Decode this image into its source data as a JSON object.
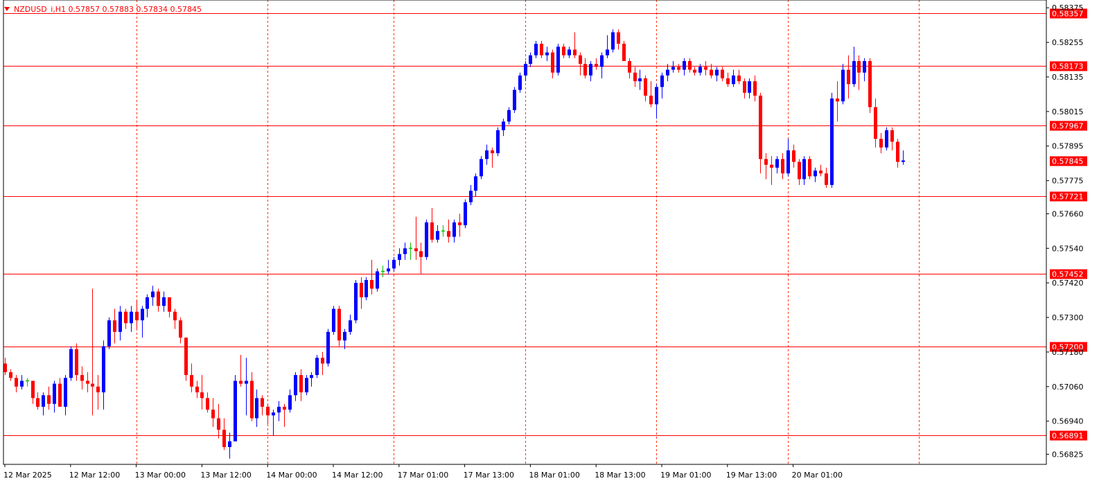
{
  "header": {
    "symbol_line": "NZDUSD_i,H1  0.57857 0.57883 0.57834 0.57845"
  },
  "colors": {
    "bull": "#0000ff",
    "bear": "#ff0000",
    "doji": "#00c000",
    "level_line": "#ff0000",
    "grid": "#ff3300",
    "background": "#ffffff"
  },
  "chart_data": {
    "type": "candlestick",
    "symbol": "NZDUSD_i",
    "timeframe": "H1",
    "ylim": [
      0.5679,
      0.5839
    ],
    "y_ticks": [
      "0.58375",
      "0.58255",
      "0.58135",
      "0.58015",
      "0.57895",
      "0.57775",
      "0.57660",
      "0.57540",
      "0.57420",
      "0.57300",
      "0.57180",
      "0.57060",
      "0.56940",
      "0.56825"
    ],
    "x_labels": [
      "12 Mar 2025",
      "12 Mar 12:00",
      "13 Mar 00:00",
      "13 Mar 12:00",
      "14 Mar 00:00",
      "14 Mar 12:00",
      "17 Mar 01:00",
      "17 Mar 13:00",
      "18 Mar 01:00",
      "18 Mar 13:00",
      "19 Mar 01:00",
      "19 Mar 13:00",
      "20 Mar 01:00"
    ],
    "x_label_slots": [
      0,
      12,
      24,
      36,
      48,
      60,
      72,
      84,
      96,
      108,
      120,
      132,
      144
    ],
    "separator_slots": [
      24,
      48,
      71,
      95,
      119,
      143,
      167
    ],
    "horizontal_levels": [
      "0.58357",
      "0.58173",
      "0.57967",
      "0.57721",
      "0.57452",
      "0.57200",
      "0.56891"
    ],
    "current_price": "0.57845",
    "candles": [
      [
        0.5714,
        0.5716,
        0.571,
        0.5711
      ],
      [
        0.5711,
        0.5712,
        0.5708,
        0.5709
      ],
      [
        0.5709,
        0.571,
        0.5704,
        0.5706
      ],
      [
        0.5706,
        0.571,
        0.5705,
        0.5708
      ],
      [
        0.5708,
        0.5709,
        0.5706,
        0.5708
      ],
      [
        0.5708,
        0.5708,
        0.57,
        0.5702
      ],
      [
        0.5702,
        0.5704,
        0.5698,
        0.5699
      ],
      [
        0.5699,
        0.5704,
        0.5696,
        0.5703
      ],
      [
        0.5703,
        0.5706,
        0.5698,
        0.57
      ],
      [
        0.57,
        0.5708,
        0.5697,
        0.5707
      ],
      [
        0.5707,
        0.5709,
        0.57,
        0.5699
      ],
      [
        0.5699,
        0.571,
        0.5696,
        0.5709
      ],
      [
        0.5709,
        0.572,
        0.5708,
        0.5719
      ],
      [
        0.5719,
        0.5721,
        0.5708,
        0.571
      ],
      [
        0.571,
        0.5713,
        0.5705,
        0.5708
      ],
      [
        0.5708,
        0.5711,
        0.5704,
        0.5707
      ],
      [
        0.5707,
        0.574,
        0.5696,
        0.5706
      ],
      [
        0.5706,
        0.571,
        0.5698,
        0.5704
      ],
      [
        0.5704,
        0.5722,
        0.5698,
        0.572
      ],
      [
        0.572,
        0.573,
        0.5719,
        0.5729
      ],
      [
        0.5729,
        0.5733,
        0.5721,
        0.5725
      ],
      [
        0.5725,
        0.5734,
        0.5722,
        0.5732
      ],
      [
        0.5732,
        0.5733,
        0.5726,
        0.5728
      ],
      [
        0.5728,
        0.5734,
        0.5725,
        0.5732
      ],
      [
        0.5732,
        0.5736,
        0.5726,
        0.5729
      ],
      [
        0.5729,
        0.5734,
        0.5723,
        0.5733
      ],
      [
        0.5733,
        0.5738,
        0.573,
        0.5737
      ],
      [
        0.5737,
        0.5741,
        0.5734,
        0.5739
      ],
      [
        0.5739,
        0.574,
        0.5732,
        0.5734
      ],
      [
        0.5734,
        0.5739,
        0.5732,
        0.5737
      ],
      [
        0.5737,
        0.5737,
        0.573,
        0.5732
      ],
      [
        0.5732,
        0.5733,
        0.5726,
        0.5729
      ],
      [
        0.5729,
        0.573,
        0.5721,
        0.5723
      ],
      [
        0.5723,
        0.5723,
        0.5708,
        0.571
      ],
      [
        0.571,
        0.5714,
        0.5704,
        0.5706
      ],
      [
        0.5706,
        0.5708,
        0.5702,
        0.5704
      ],
      [
        0.5704,
        0.571,
        0.5698,
        0.5702
      ],
      [
        0.5702,
        0.5704,
        0.5697,
        0.5698
      ],
      [
        0.5698,
        0.5702,
        0.5692,
        0.5695
      ],
      [
        0.5695,
        0.57,
        0.5688,
        0.5691
      ],
      [
        0.5691,
        0.5695,
        0.5684,
        0.5685
      ],
      [
        0.5685,
        0.569,
        0.5681,
        0.5687
      ],
      [
        0.5687,
        0.571,
        0.5687,
        0.5708
      ],
      [
        0.5708,
        0.5717,
        0.5706,
        0.5707
      ],
      [
        0.5707,
        0.5716,
        0.5696,
        0.5708
      ],
      [
        0.5708,
        0.5711,
        0.5694,
        0.5695
      ],
      [
        0.5695,
        0.5705,
        0.5692,
        0.5702
      ],
      [
        0.5702,
        0.5703,
        0.5696,
        0.5699
      ],
      [
        0.5699,
        0.57,
        0.5693,
        0.5696
      ],
      [
        0.5696,
        0.5698,
        0.5689,
        0.5697
      ],
      [
        0.5697,
        0.5701,
        0.5694,
        0.5699
      ],
      [
        0.5699,
        0.57,
        0.5692,
        0.5698
      ],
      [
        0.5698,
        0.5705,
        0.5697,
        0.5703
      ],
      [
        0.5703,
        0.5711,
        0.5701,
        0.571
      ],
      [
        0.571,
        0.5712,
        0.5701,
        0.5704
      ],
      [
        0.5704,
        0.571,
        0.5703,
        0.5709
      ],
      [
        0.5709,
        0.5711,
        0.5706,
        0.571
      ],
      [
        0.571,
        0.5717,
        0.5709,
        0.5716
      ],
      [
        0.5716,
        0.5718,
        0.571,
        0.5714
      ],
      [
        0.5714,
        0.5726,
        0.5713,
        0.5725
      ],
      [
        0.5725,
        0.5734,
        0.5724,
        0.5733
      ],
      [
        0.5733,
        0.5734,
        0.572,
        0.5722
      ],
      [
        0.5722,
        0.5726,
        0.5719,
        0.5725
      ],
      [
        0.5725,
        0.5731,
        0.5724,
        0.5729
      ],
      [
        0.5729,
        0.5743,
        0.5728,
        0.5742
      ],
      [
        0.5742,
        0.5744,
        0.5733,
        0.5737
      ],
      [
        0.5737,
        0.5744,
        0.5736,
        0.5743
      ],
      [
        0.5743,
        0.575,
        0.5738,
        0.574
      ],
      [
        0.574,
        0.5747,
        0.5739,
        0.5746
      ],
      [
        0.5746,
        0.5748,
        0.5744,
        0.5746
      ],
      [
        0.5746,
        0.575,
        0.5745,
        0.5747
      ],
      [
        0.5747,
        0.5751,
        0.5746,
        0.575
      ],
      [
        0.575,
        0.5754,
        0.5748,
        0.5752
      ],
      [
        0.5752,
        0.5756,
        0.575,
        0.5754
      ],
      [
        0.5754,
        0.5756,
        0.575,
        0.5754
      ],
      [
        0.5754,
        0.5765,
        0.575,
        0.5753
      ],
      [
        0.5753,
        0.5756,
        0.5745,
        0.5751
      ],
      [
        0.5751,
        0.5764,
        0.575,
        0.5763
      ],
      [
        0.5763,
        0.5768,
        0.5756,
        0.5757
      ],
      [
        0.5757,
        0.5762,
        0.5756,
        0.576
      ],
      [
        0.576,
        0.5762,
        0.5758,
        0.576
      ],
      [
        0.576,
        0.5764,
        0.5756,
        0.5758
      ],
      [
        0.5758,
        0.5764,
        0.5756,
        0.5763
      ],
      [
        0.5763,
        0.5766,
        0.5758,
        0.5762
      ],
      [
        0.5762,
        0.5771,
        0.5761,
        0.577
      ],
      [
        0.577,
        0.5776,
        0.5769,
        0.5774
      ],
      [
        0.5774,
        0.578,
        0.5772,
        0.5779
      ],
      [
        0.5779,
        0.5786,
        0.5778,
        0.5785
      ],
      [
        0.5785,
        0.579,
        0.5783,
        0.5788
      ],
      [
        0.5788,
        0.5789,
        0.5782,
        0.5787
      ],
      [
        0.5787,
        0.5796,
        0.5786,
        0.5795
      ],
      [
        0.5795,
        0.5799,
        0.5793,
        0.5798
      ],
      [
        0.5798,
        0.5803,
        0.5797,
        0.5802
      ],
      [
        0.5802,
        0.581,
        0.5801,
        0.5809
      ],
      [
        0.5809,
        0.5815,
        0.5808,
        0.5814
      ],
      [
        0.5814,
        0.5819,
        0.5812,
        0.5818
      ],
      [
        0.5818,
        0.5822,
        0.5817,
        0.5821
      ],
      [
        0.5821,
        0.5826,
        0.582,
        0.5825
      ],
      [
        0.5825,
        0.5826,
        0.582,
        0.5821
      ],
      [
        0.5821,
        0.5824,
        0.5819,
        0.5822
      ],
      [
        0.5822,
        0.5823,
        0.5813,
        0.5815
      ],
      [
        0.5815,
        0.5825,
        0.5814,
        0.5824
      ],
      [
        0.5824,
        0.5825,
        0.582,
        0.5821
      ],
      [
        0.5821,
        0.5824,
        0.582,
        0.5823
      ],
      [
        0.5823,
        0.5829,
        0.582,
        0.5821
      ],
      [
        0.5821,
        0.5822,
        0.5814,
        0.5818
      ],
      [
        0.5818,
        0.582,
        0.5813,
        0.5814
      ],
      [
        0.5814,
        0.5819,
        0.5812,
        0.5818
      ],
      [
        0.5818,
        0.582,
        0.5816,
        0.5817
      ],
      [
        0.5817,
        0.5822,
        0.5813,
        0.5821
      ],
      [
        0.5821,
        0.5828,
        0.582,
        0.5823
      ],
      [
        0.5823,
        0.583,
        0.5822,
        0.5829
      ],
      [
        0.5829,
        0.583,
        0.5823,
        0.5825
      ],
      [
        0.5825,
        0.5826,
        0.582,
        0.5819
      ],
      [
        0.5819,
        0.582,
        0.5813,
        0.5815
      ],
      [
        0.5815,
        0.5817,
        0.581,
        0.5812
      ],
      [
        0.5812,
        0.5816,
        0.5809,
        0.5813
      ],
      [
        0.5813,
        0.5814,
        0.5805,
        0.5807
      ],
      [
        0.5807,
        0.5812,
        0.5803,
        0.5804
      ],
      [
        0.5804,
        0.5811,
        0.5799,
        0.581
      ],
      [
        0.581,
        0.5815,
        0.5806,
        0.5814
      ],
      [
        0.5814,
        0.5818,
        0.5812,
        0.5816
      ],
      [
        0.5816,
        0.5819,
        0.5815,
        0.5817
      ],
      [
        0.5817,
        0.5818,
        0.5815,
        0.5816
      ],
      [
        0.5816,
        0.582,
        0.5814,
        0.5819
      ],
      [
        0.5819,
        0.582,
        0.5815,
        0.5816
      ],
      [
        0.5816,
        0.5817,
        0.5814,
        0.5815
      ],
      [
        0.5815,
        0.5818,
        0.5814,
        0.5817
      ],
      [
        0.5817,
        0.5819,
        0.5814,
        0.5816
      ],
      [
        0.5816,
        0.5818,
        0.5813,
        0.5814
      ],
      [
        0.5814,
        0.5817,
        0.5812,
        0.5816
      ],
      [
        0.5816,
        0.5817,
        0.5812,
        0.5813
      ],
      [
        0.5813,
        0.5815,
        0.581,
        0.5811
      ],
      [
        0.5811,
        0.5816,
        0.581,
        0.5814
      ],
      [
        0.5814,
        0.5816,
        0.5811,
        0.5812
      ],
      [
        0.5812,
        0.5813,
        0.5806,
        0.5808
      ],
      [
        0.5808,
        0.5813,
        0.5806,
        0.5812
      ],
      [
        0.5812,
        0.5814,
        0.5805,
        0.5807
      ],
      [
        0.5807,
        0.5808,
        0.578,
        0.5785
      ],
      [
        0.5785,
        0.5787,
        0.5778,
        0.5783
      ],
      [
        0.5783,
        0.5786,
        0.5776,
        0.5782
      ],
      [
        0.5782,
        0.5786,
        0.578,
        0.5785
      ],
      [
        0.5785,
        0.5787,
        0.5778,
        0.578
      ],
      [
        0.578,
        0.5792,
        0.5779,
        0.5788
      ],
      [
        0.5788,
        0.579,
        0.5782,
        0.5784
      ],
      [
        0.5784,
        0.5785,
        0.5776,
        0.5778
      ],
      [
        0.5778,
        0.5786,
        0.5776,
        0.5785
      ],
      [
        0.5785,
        0.5786,
        0.5778,
        0.5779
      ],
      [
        0.5779,
        0.5782,
        0.5777,
        0.5781
      ],
      [
        0.5781,
        0.5783,
        0.5779,
        0.578
      ],
      [
        0.578,
        0.5782,
        0.5775,
        0.5776
      ],
      [
        0.5776,
        0.5808,
        0.5775,
        0.5806
      ],
      [
        0.5806,
        0.5812,
        0.5798,
        0.5805
      ],
      [
        0.5805,
        0.5818,
        0.5804,
        0.5816
      ],
      [
        0.5816,
        0.5821,
        0.5806,
        0.5811
      ],
      [
        0.5811,
        0.5824,
        0.581,
        0.5819
      ],
      [
        0.5819,
        0.5821,
        0.5809,
        0.5815
      ],
      [
        0.5815,
        0.582,
        0.5812,
        0.5819
      ],
      [
        0.5819,
        0.582,
        0.5801,
        0.5803
      ],
      [
        0.5803,
        0.5806,
        0.5789,
        0.5792
      ],
      [
        0.5792,
        0.5794,
        0.5787,
        0.5789
      ],
      [
        0.5789,
        0.5796,
        0.5788,
        0.5795
      ],
      [
        0.5795,
        0.5796,
        0.5788,
        0.5791
      ],
      [
        0.5791,
        0.5792,
        0.5782,
        0.5784
      ],
      [
        0.5784,
        0.5788,
        0.5783,
        0.57845
      ]
    ]
  }
}
